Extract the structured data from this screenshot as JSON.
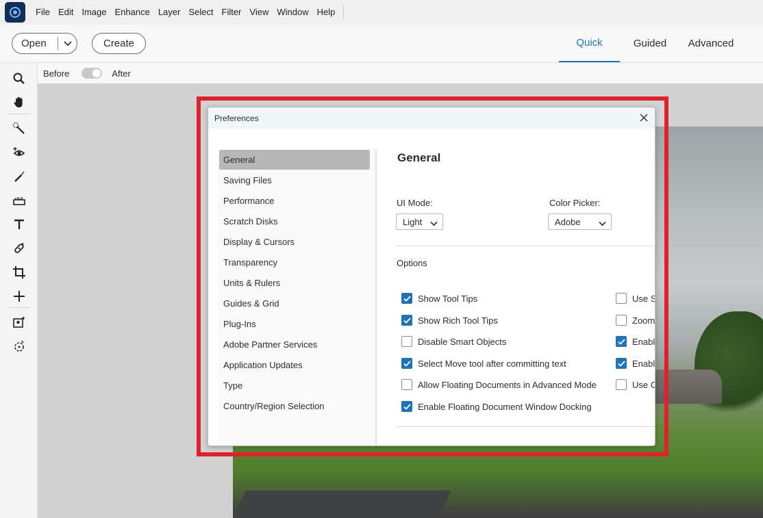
{
  "menubar": {
    "items": [
      "File",
      "Edit",
      "Image",
      "Enhance",
      "Layer",
      "Select",
      "Filter",
      "View",
      "Window",
      "Help"
    ]
  },
  "actionbar": {
    "open_label": "Open",
    "create_label": "Create",
    "modes": [
      "Quick",
      "Guided",
      "Advanced"
    ],
    "active_mode": "Quick"
  },
  "optionsbar": {
    "before_label": "Before",
    "after_label": "After"
  },
  "toolbar": {
    "tools": [
      "zoom-icon",
      "hand-icon",
      "quick-selection-icon",
      "red-eye-icon",
      "whiten-teeth-icon",
      "straighten-icon",
      "text-icon",
      "spot-healing-icon",
      "crop-icon",
      "move-icon",
      "perfect-portrait-icon",
      "smart-brush-icon"
    ]
  },
  "dialog": {
    "title": "Preferences",
    "nav_items": [
      "General",
      "Saving Files",
      "Performance",
      "Scratch Disks",
      "Display & Cursors",
      "Transparency",
      "Units & Rulers",
      "Guides & Grid",
      "Plug-Ins",
      "Adobe Partner Services",
      "Application Updates",
      "Type",
      "Country/Region Selection"
    ],
    "selected_nav": "General",
    "content": {
      "title": "General",
      "ui_mode_label": "UI Mode:",
      "ui_mode_value": "Light",
      "color_picker_label": "Color Picker:",
      "color_picker_value": "Adobe",
      "options_label": "Options",
      "options_left": [
        {
          "label": "Show Tool Tips",
          "checked": true
        },
        {
          "label": "Show Rich Tool Tips",
          "checked": true
        },
        {
          "label": "Disable Smart Objects",
          "checked": false
        },
        {
          "label": "Select Move tool after committing text",
          "checked": true
        },
        {
          "label": "Allow Floating Documents in Advanced Mode",
          "checked": false
        },
        {
          "label": "Enable Floating Document Window Docking",
          "checked": true
        }
      ],
      "options_right": [
        {
          "label": "Use Sh",
          "checked": false
        },
        {
          "label": "Zoom",
          "checked": false
        },
        {
          "label": "Enabl",
          "checked": true
        },
        {
          "label": "Enabl",
          "checked": true
        },
        {
          "label": "Use C",
          "checked": false
        }
      ]
    }
  },
  "colors": {
    "accent": "#1f73b7",
    "highlight": "#e0202a",
    "selected_nav": "#b8b8b8"
  }
}
